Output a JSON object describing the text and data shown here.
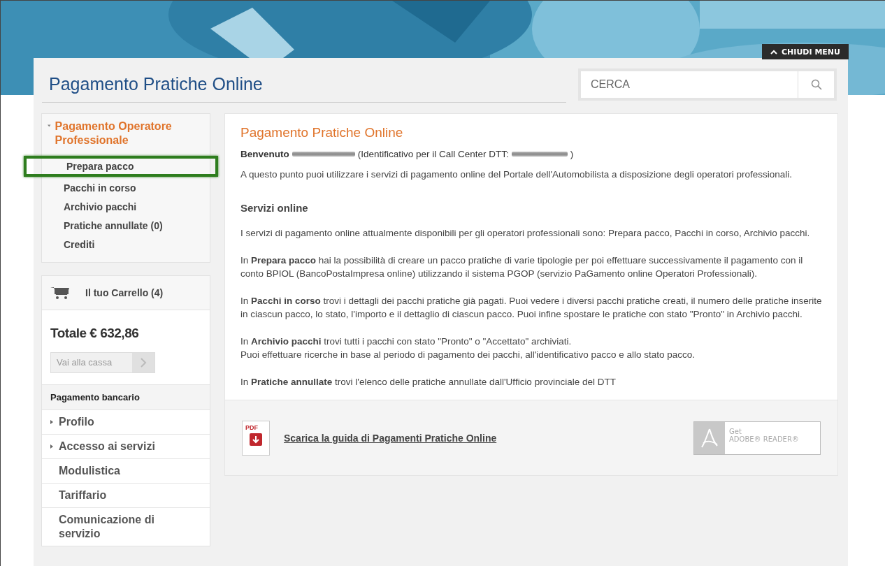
{
  "header": {
    "title": "Pagamento Pratiche Online",
    "menu_toggle": "CHIUDI MENU",
    "search": {
      "placeholder": "CERCA"
    }
  },
  "sidebar": {
    "section": {
      "title": "Pagamento Operatore Professionale",
      "expanded": true,
      "items": [
        {
          "label": "Prepara pacco",
          "highlighted": true
        },
        {
          "label": "Pacchi in corso",
          "highlighted": false
        },
        {
          "label": "Archivio pacchi",
          "highlighted": false
        },
        {
          "label": "Pratiche annullate (0)",
          "highlighted": false
        },
        {
          "label": "Crediti",
          "highlighted": false
        }
      ]
    },
    "cart": {
      "title": "Il tuo Carrello (4)",
      "total": "Totale € 632,86",
      "checkout": "Vai alla cassa"
    },
    "nav_heading": "Pagamento bancario",
    "nav": [
      {
        "label": "Profilo",
        "kind": "expandable"
      },
      {
        "label": "Accesso ai servizi",
        "kind": "expandable"
      },
      {
        "label": "Modulistica",
        "kind": "link"
      },
      {
        "label": "Tariffario",
        "kind": "link"
      },
      {
        "label": "Comunicazione di servizio",
        "kind": "link"
      }
    ]
  },
  "main": {
    "title": "Pagamento Pratiche Online",
    "welcome": {
      "greeting": "Benvenuto",
      "id_label": "(Identificativo per il Call Center DTT:",
      "close": ")"
    },
    "intro": "A questo punto puoi utilizzare i servizi di pagamento online del Portale dell'Automobilista a disposizione degli operatori professionali.",
    "section_title": "Servizi online",
    "paragraphs": [
      "I servizi di pagamento online attualmente disponibili per gli operatori professionali sono: Prepara pacco, Pacchi in corso, Archivio pacchi.",
      "In **Prepara pacco** hai la possibilità di creare un pacco pratiche di varie tipologie per poi effettuare successivamente il pagamento con il conto BPIOL (BancoPostaImpresa online) utilizzando il sistema PGOP (servizio PaGamento online Operatori Professionali).",
      "In **Pacchi in corso** trovi i dettagli dei pacchi pratiche già pagati. Puoi vedere i diversi pacchi pratiche creati, il numero delle pratiche inserite in ciascun pacco, lo stato, l'importo e il dettaglio di ciascun pacco. Puoi infine spostare le pratiche con stato \"Pronto\" in Archivio pacchi.",
      "In **Archivio pacchi** trovi tutti i pacchi con stato \"Pronto\" o \"Accettato\" archiviati.\nPuoi effettuare ricerche in base al periodo di pagamento dei pacchi, all'identificativo pacco e allo stato pacco.",
      "In **Pratiche annullate** trovi l'elenco delle pratiche annullate dall'Ufficio provinciale del DTT"
    ],
    "footer": {
      "pdf_label": "PDF",
      "download_link": "Scarica la guida di Pagamenti Pratiche Online",
      "adobe_get": "Get",
      "adobe_name": "ADOBE® READER®"
    }
  }
}
